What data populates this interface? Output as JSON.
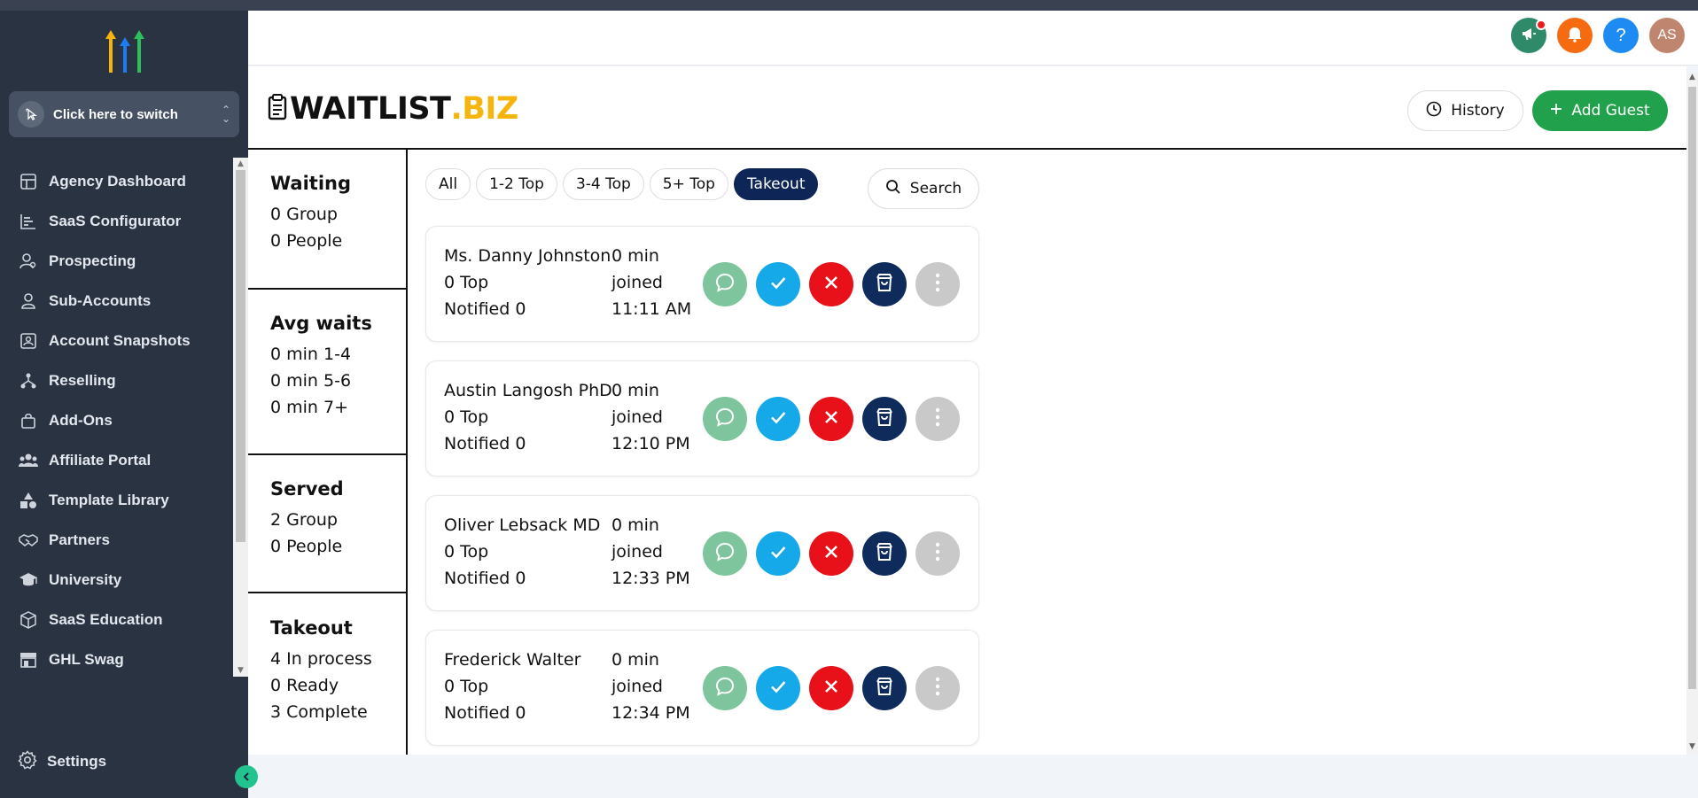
{
  "sidebar": {
    "switcher_label": "Click here to switch",
    "items": [
      {
        "label": "Agency Dashboard",
        "icon": "dashboard-icon"
      },
      {
        "label": "SaaS Configurator",
        "icon": "chart-icon"
      },
      {
        "label": "Prospecting",
        "icon": "prospect-icon"
      },
      {
        "label": "Sub-Accounts",
        "icon": "user-icon"
      },
      {
        "label": "Account Snapshots",
        "icon": "snapshot-icon"
      },
      {
        "label": "Reselling",
        "icon": "reselling-icon"
      },
      {
        "label": "Add-Ons",
        "icon": "bag-icon"
      },
      {
        "label": "Affiliate Portal",
        "icon": "people-icon"
      },
      {
        "label": "Template Library",
        "icon": "shapes-icon"
      },
      {
        "label": "Partners",
        "icon": "handshake-icon"
      },
      {
        "label": "University",
        "icon": "graduation-icon"
      },
      {
        "label": "SaaS Education",
        "icon": "box-icon"
      },
      {
        "label": "GHL Swag",
        "icon": "store-icon"
      }
    ],
    "settings_label": "Settings"
  },
  "topbar": {
    "avatar_initials": "AS",
    "help_label": "?"
  },
  "brand": {
    "part1": "WAITLIST",
    "part2": ".BIZ"
  },
  "buttons": {
    "history": "History",
    "add_guest": "Add Guest",
    "search": "Search"
  },
  "stats": {
    "waiting": {
      "title": "Waiting",
      "lines": [
        "0 Group",
        "0 People"
      ]
    },
    "avg_waits": {
      "title": "Avg waits",
      "lines": [
        "0 min 1-4",
        "0 min 5-6",
        "0 min 7+"
      ]
    },
    "served": {
      "title": "Served",
      "lines": [
        "2 Group",
        "0 People"
      ]
    },
    "takeout": {
      "title": "Takeout",
      "lines": [
        "4 In process",
        "0 Ready",
        "3 Complete"
      ]
    }
  },
  "filters": [
    "All",
    "1-2 Top",
    "3-4 Top",
    "5+ Top",
    "Takeout"
  ],
  "active_filter": "Takeout",
  "guests": [
    {
      "name": "Ms. Danny Johnston",
      "party": "0 Top",
      "notified": "Notified 0",
      "wait": "0 min",
      "joined": "joined",
      "time": "11:11 AM"
    },
    {
      "name": "Austin Langosh PhD",
      "party": "0 Top",
      "notified": "Notified 0",
      "wait": "0 min",
      "joined": "joined",
      "time": "12:10 PM"
    },
    {
      "name": "Oliver Lebsack MD",
      "party": "0 Top",
      "notified": "Notified 0",
      "wait": "0 min",
      "joined": "joined",
      "time": "12:33 PM"
    },
    {
      "name": "Frederick Walter",
      "party": "0 Top",
      "notified": "Notified 0",
      "wait": "0 min",
      "joined": "joined",
      "time": "12:34 PM"
    }
  ],
  "colors": {
    "sidebar_bg": "#2a3342",
    "brand_accent": "#f5b50c",
    "add_guest_green": "#22a14c",
    "active_chip": "#0e2557"
  }
}
